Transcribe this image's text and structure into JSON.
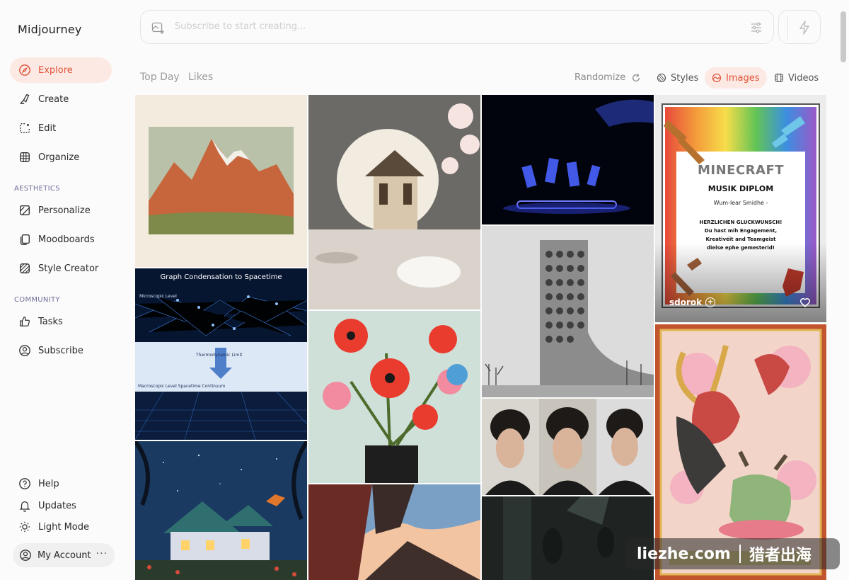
{
  "app": {
    "name": "Midjourney"
  },
  "sidebar": {
    "primary": [
      {
        "label": "Explore",
        "icon": "compass-icon"
      },
      {
        "label": "Create",
        "icon": "brush-icon"
      },
      {
        "label": "Edit",
        "icon": "edit-icon"
      },
      {
        "label": "Organize",
        "icon": "grid-icon"
      }
    ],
    "aesthetics_label": "AESTHETICS",
    "aesthetics": [
      {
        "label": "Personalize",
        "icon": "personalize-icon"
      },
      {
        "label": "Moodboards",
        "icon": "moodboards-icon"
      },
      {
        "label": "Style Creator",
        "icon": "style-creator-icon"
      }
    ],
    "community_label": "COMMUNITY",
    "community": [
      {
        "label": "Tasks",
        "icon": "thumbs-up-icon"
      },
      {
        "label": "Subscribe",
        "icon": "user-circle-icon"
      }
    ],
    "bottom": [
      {
        "label": "Help",
        "icon": "help-icon"
      },
      {
        "label": "Updates",
        "icon": "bell-icon"
      },
      {
        "label": "Light Mode",
        "icon": "sun-icon"
      }
    ],
    "account": {
      "label": "My Account",
      "more": "···"
    }
  },
  "prompt": {
    "placeholder": "Subscribe to start creating..."
  },
  "filters": {
    "tabs": [
      "Top Day",
      "Likes"
    ],
    "randomize": "Randomize",
    "styles": "Styles",
    "images": "Images",
    "videos": "Videos"
  },
  "cards": {
    "featured_user": "sdorok",
    "graph_title": "Graph Condensation to Spacetime",
    "graph_sub1": "Microscopic Level",
    "graph_sub2": "Thermodynamic Limit",
    "graph_sub3": "Macroscopic Level Spacetime Continuum",
    "mc_logo": "MINECRAFT",
    "mc_title": "MUSIK DIPLOM",
    "mc_name": "Wum-lear Smidhe -",
    "mc_congrats": "HERZLICHEN GLUCKWUNSCH!",
    "mc_line1": "Du hast mih Engagement,",
    "mc_line2": "Kreativéit and Teamgeist",
    "mc_line3": "dielse ephe gemesterid!"
  },
  "watermark": {
    "left": "liezhe.com",
    "right": "猎者出海"
  },
  "colors": {
    "accent": "#e0533a",
    "active_bg": "#fde9e3"
  }
}
